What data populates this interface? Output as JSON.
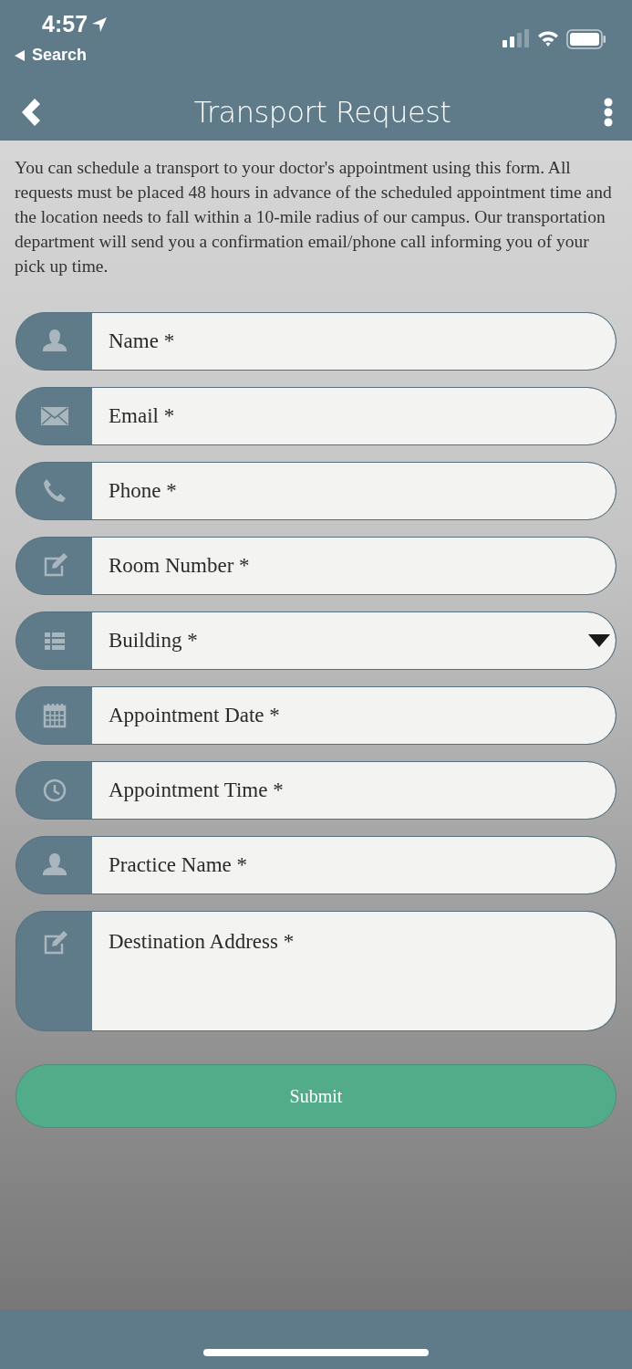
{
  "status_bar": {
    "time": "4:57",
    "back_label": "Search"
  },
  "header": {
    "title": "Transport Request"
  },
  "intro": "You can schedule a transport to your doctor's appointment using this form. All requests must be placed 48 hours in advance of the scheduled appointment time and the location needs to fall within a 10-mile radius of our campus. Our transportation department will send you a confirmation email/phone call informing you of your pick up time.",
  "fields": [
    {
      "kind": "input",
      "placeholder": "Name *"
    },
    {
      "kind": "input",
      "placeholder": "Email *"
    },
    {
      "kind": "input",
      "placeholder": "Phone *"
    },
    {
      "kind": "input",
      "placeholder": "Room Number *"
    },
    {
      "kind": "select",
      "placeholder": "Building *"
    },
    {
      "kind": "input",
      "placeholder": "Appointment Date *"
    },
    {
      "kind": "input",
      "placeholder": "Appointment Time *"
    },
    {
      "kind": "input",
      "placeholder": "Practice Name *"
    },
    {
      "kind": "textarea",
      "placeholder": "Destination Address *"
    }
  ],
  "submit": "Submit"
}
